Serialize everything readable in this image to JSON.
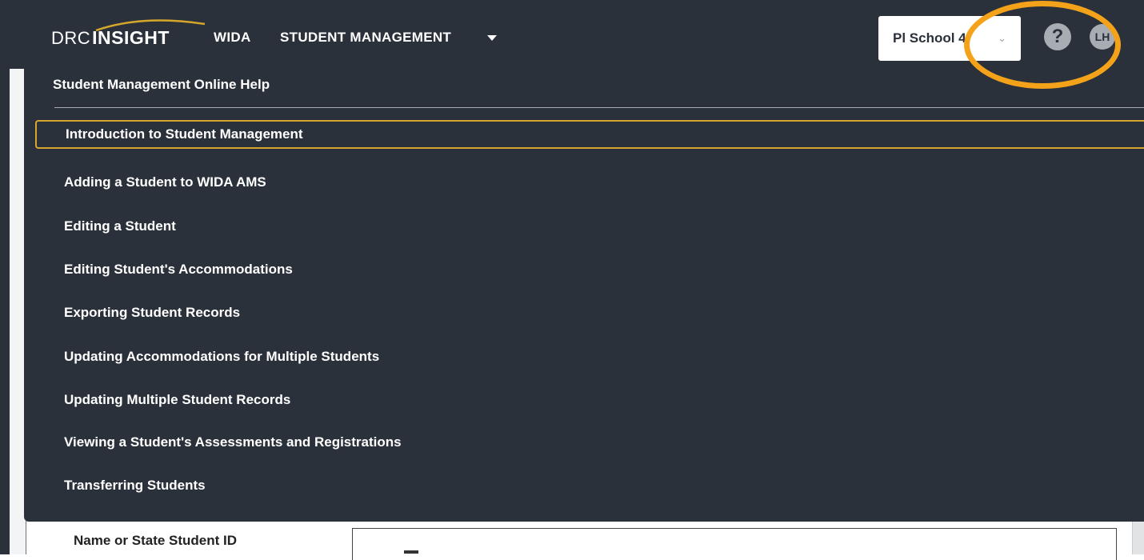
{
  "header": {
    "logo_drc": "DRC",
    "logo_insight": "INSIGHT",
    "nav": {
      "wida": "WIDA",
      "student_management": "STUDENT MANAGEMENT"
    },
    "school_select": {
      "value": "Pl School 4"
    },
    "help_icon": "?",
    "avatar_initials": "LH"
  },
  "help_menu": {
    "title": "Student Management Online Help",
    "items": [
      {
        "label": "Introduction to Student Management",
        "selected": true
      },
      {
        "label": "Adding a Student to WIDA AMS"
      },
      {
        "label": "Editing a Student"
      },
      {
        "label": "Editing Student's Accommodations"
      },
      {
        "label": "Exporting Student Records"
      },
      {
        "label": "Updating Accommodations for Multiple Students"
      },
      {
        "label": "Updating Multiple Student Records"
      },
      {
        "label": "Viewing a Student's Assessments and Registrations"
      },
      {
        "label": "Transferring Students"
      }
    ]
  },
  "search": {
    "label": "Name or State Student ID"
  },
  "colors": {
    "nav_background": "#2b313a",
    "highlight_ring": "#f4a21a",
    "selected_border": "#d4a72c",
    "icon_circle": "#a8adb3"
  }
}
